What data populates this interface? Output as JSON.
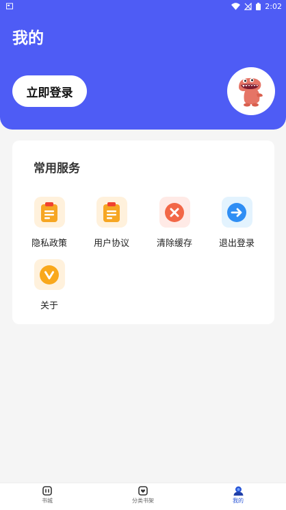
{
  "status_bar": {
    "time": "2:02"
  },
  "header": {
    "title": "我的",
    "login_label": "立即登录"
  },
  "services": {
    "title": "常用服务",
    "items": [
      {
        "label": "隐私政策",
        "icon": "clipboard-icon",
        "bg": "#fff1dc",
        "fg": "#f6a623"
      },
      {
        "label": "用户协议",
        "icon": "clipboard-icon",
        "bg": "#fff1dc",
        "fg": "#f6a623"
      },
      {
        "label": "清除缓存",
        "icon": "close-circle-icon",
        "bg": "#ffeae6",
        "fg": "#f26747"
      },
      {
        "label": "退出登录",
        "icon": "arrow-right-circle-icon",
        "bg": "#e3f3fe",
        "fg": "#2f8ef4"
      },
      {
        "label": "关于",
        "icon": "v-circle-icon",
        "bg": "#fff1dc",
        "fg": "#f9a81c"
      }
    ]
  },
  "tabbar": {
    "tabs": [
      {
        "label": "书城",
        "icon": "bookstore-icon"
      },
      {
        "label": "分类书架",
        "icon": "bookshelf-icon"
      },
      {
        "label": "我的",
        "icon": "profile-icon",
        "active": true
      }
    ]
  },
  "colors": {
    "primary": "#4e5cf5",
    "active_tab": "#2a56d6"
  }
}
